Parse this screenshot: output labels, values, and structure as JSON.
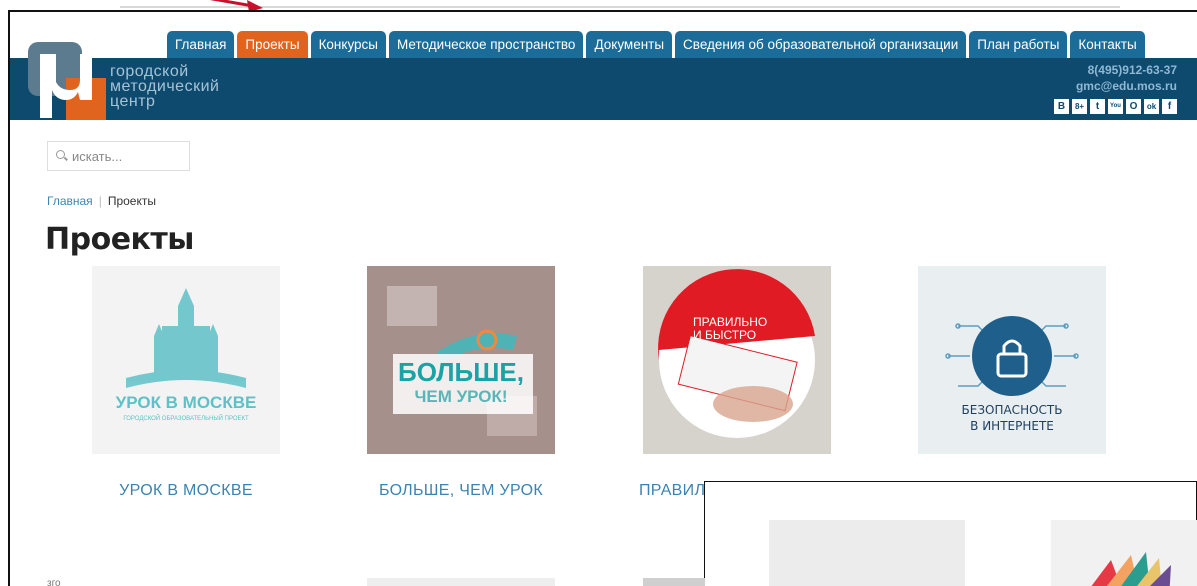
{
  "nav": {
    "tabs": [
      {
        "label": "Главная",
        "active": false
      },
      {
        "label": "Проекты",
        "active": true
      },
      {
        "label": "Конкурсы",
        "active": false
      },
      {
        "label": "Методическое пространство",
        "active": false
      },
      {
        "label": "Документы",
        "active": false
      },
      {
        "label": "Сведения об образовательной организации",
        "active": false
      },
      {
        "label": "План работы",
        "active": false
      },
      {
        "label": "Контакты",
        "active": false
      }
    ]
  },
  "logo": {
    "lines": [
      "городской",
      "методический",
      "центр"
    ]
  },
  "contact": {
    "phone": "8(495)912-63-37",
    "email": "gmc@edu.mos.ru"
  },
  "socials": [
    {
      "icon": "vk-icon",
      "glyph": "B"
    },
    {
      "icon": "google-plus-icon",
      "glyph": "8+"
    },
    {
      "icon": "twitter-icon",
      "glyph": "t"
    },
    {
      "icon": "youtube-icon",
      "glyph": "You"
    },
    {
      "icon": "livejournal-icon",
      "glyph": "O"
    },
    {
      "icon": "odnoklassniki-icon",
      "glyph": "ok"
    },
    {
      "icon": "facebook-icon",
      "glyph": "f"
    }
  ],
  "search": {
    "placeholder": "искать..."
  },
  "breadcrumb": {
    "home": "Главная",
    "current": "Проекты"
  },
  "page": {
    "title": "Проекты"
  },
  "projects": [
    {
      "title": "УРОК В МОСКВЕ",
      "image_text": "УРОК В МОСКВЕ",
      "image_subtext": "ГОРОДСКОЙ ОБРАЗОВАТЕЛЬНЫЙ ПРОЕКТ"
    },
    {
      "title": "БОЛЬШЕ, ЧЕМ УРОК",
      "image_text": "БОЛЬШЕ,",
      "image_subtext": "ЧЕМ УРОК!"
    },
    {
      "title": "ПРАВИЛ",
      "image_text": "ПРАВИЛЬНО",
      "image_subtext": "И БЫСТРО"
    },
    {
      "title": "",
      "image_text": "БЕЗОПАСНОСТЬ",
      "image_subtext": "В ИНТЕРНЕТЕ"
    }
  ],
  "bottom_fragment": "зго",
  "colors": {
    "header": "#0e4a6e",
    "tab": "#1c6c9a",
    "tab_active": "#e0641e",
    "link": "#3c83b1"
  }
}
